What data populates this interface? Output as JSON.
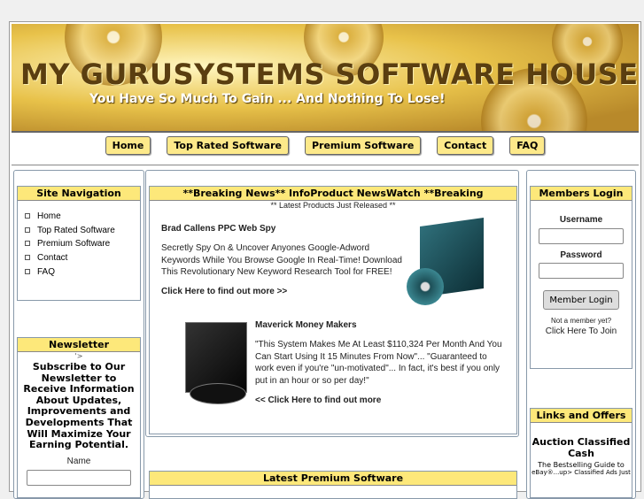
{
  "header": {
    "title": "MY GURUSYSTEMS SOFTWARE HOUSE",
    "tagline": "You Have So Much To Gain ... And Nothing To Lose!"
  },
  "nav": [
    "Home",
    "Top Rated Software",
    "Premium Software",
    "Contact",
    "FAQ"
  ],
  "site_nav": {
    "title": "Site Navigation",
    "items": [
      "Home",
      "Top Rated Software",
      "Premium Software",
      "Contact",
      "FAQ"
    ]
  },
  "newsletter": {
    "title": "Newsletter",
    "stray": "'>",
    "text": "Subscribe to Our Newsletter to Receive Information About Updates, Improvements and Developments That Will Maximize Your Earning Potential.",
    "name_label": "Name"
  },
  "news": {
    "title": "**Breaking News** InfoProduct NewsWatch **Breaking",
    "subtitle": "** Latest Products Just Released **",
    "products": [
      {
        "name": "Brad Callens PPC Web Spy",
        "desc": "Secretly Spy On & Uncover Anyones Google-Adword Keywords While You Browse Google In Real-Time! Download This Revolutionary New Keyword Research Tool for FREE!",
        "link": "Click Here to find out more >>"
      },
      {
        "name": "Maverick Money Makers",
        "desc": "\"This System Makes Me At Least $110,324 Per Month And You Can Start Using It 15 Minutes From Now\"... \"Guaranteed to work even if you're \"un-motivated\"... In fact, it's best if you only put in an hour or so per day!\"",
        "link": "<< Click Here to find out more"
      }
    ]
  },
  "premium": {
    "title": "Latest Premium Software"
  },
  "login": {
    "title": "Members Login",
    "username": "Username",
    "password": "Password",
    "button": "Member Login",
    "not_member": "Not a member yet?",
    "join": "Click Here To Join"
  },
  "links": {
    "title": "Links and Offers",
    "heading": "Auction Classified Cash",
    "text": "The Bestselling Guide to",
    "text2": "eBay®...up> Classified Ads Just"
  }
}
